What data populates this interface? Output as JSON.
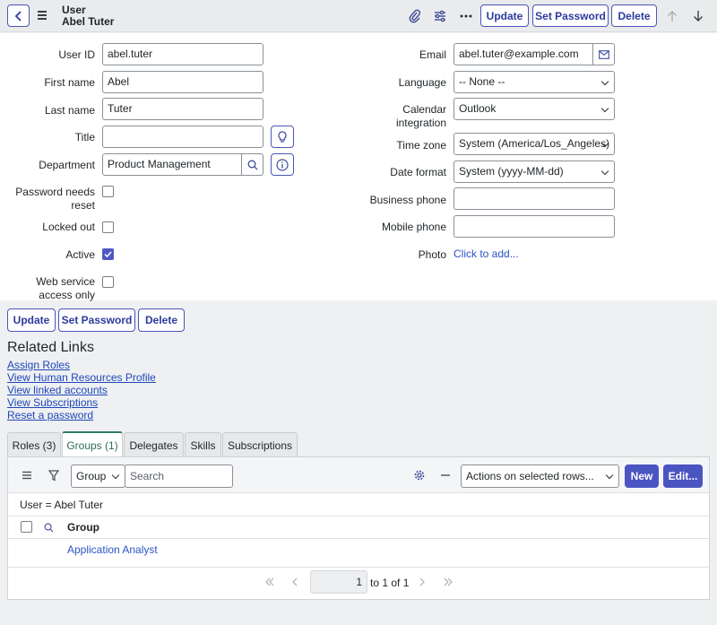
{
  "header": {
    "title_line1": "User",
    "title_line2": "Abel Tuter",
    "update_label": "Update",
    "set_password_label": "Set Password",
    "delete_label": "Delete"
  },
  "form": {
    "user_id": {
      "label": "User ID",
      "value": "abel.tuter"
    },
    "first_name": {
      "label": "First name",
      "value": "Abel"
    },
    "last_name": {
      "label": "Last name",
      "value": "Tuter"
    },
    "title": {
      "label": "Title",
      "value": ""
    },
    "department": {
      "label": "Department",
      "value": "Product Management"
    },
    "password_needs_reset": {
      "label1": "Password needs",
      "label2": "reset",
      "checked": false
    },
    "locked_out": {
      "label": "Locked out",
      "checked": false
    },
    "active": {
      "label": "Active",
      "checked": true
    },
    "web_service": {
      "label1": "Web service",
      "label2": "access only",
      "checked": false
    },
    "email": {
      "label": "Email",
      "value": "abel.tuter@example.com"
    },
    "language": {
      "label": "Language",
      "value": "-- None --"
    },
    "calendar": {
      "label1": "Calendar",
      "label2": "integration",
      "value": "Outlook"
    },
    "time_zone": {
      "label": "Time zone",
      "value": "System (America/Los_Angeles)"
    },
    "date_format": {
      "label": "Date format",
      "value": "System (yyyy-MM-dd)"
    },
    "business_phone": {
      "label": "Business phone",
      "value": ""
    },
    "mobile_phone": {
      "label": "Mobile phone",
      "value": ""
    },
    "photo": {
      "label": "Photo",
      "link": "Click to add..."
    }
  },
  "bottom_buttons": {
    "update_label": "Update",
    "set_password_label": "Set Password",
    "delete_label": "Delete"
  },
  "related_links": {
    "title": "Related Links",
    "items": [
      "Assign Roles",
      "View Human Resources Profile",
      "View linked accounts",
      "View Subscriptions",
      "Reset a password"
    ]
  },
  "tabs": [
    {
      "label": "Roles (3)",
      "active": false
    },
    {
      "label": "Groups (1)",
      "active": true
    },
    {
      "label": "Delegates",
      "active": false
    },
    {
      "label": "Skills",
      "active": false
    },
    {
      "label": "Subscriptions",
      "active": false
    }
  ],
  "list": {
    "field_select": "Group",
    "search_placeholder": "Search",
    "actions_select": "Actions on selected rows...",
    "new_label": "New",
    "edit_label": "Edit...",
    "breadcrumb": "User = Abel Tuter",
    "column_header": "Group",
    "rows": [
      "Application Analyst"
    ],
    "pager": {
      "page": "1",
      "range_text": "to 1 of 1"
    }
  },
  "colors": {
    "accent": "#4b55c2",
    "tab_active": "#2e7d68",
    "link": "#2b52c4"
  }
}
